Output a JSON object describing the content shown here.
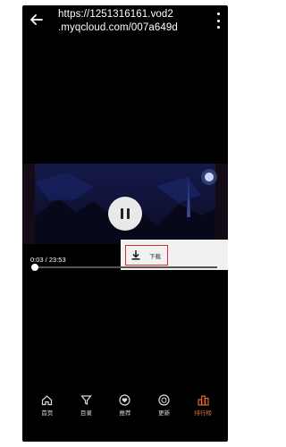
{
  "header": {
    "url": "https://1251316161.vod2\n.myqcloud.com/007a649d"
  },
  "player": {
    "time": "0:03 / 23:53",
    "progress_fraction": 0.02
  },
  "download": {
    "label": "下载"
  },
  "tabs": [
    {
      "label": "首页",
      "icon": "home-icon",
      "active": false
    },
    {
      "label": "目录",
      "icon": "filter-icon",
      "active": false
    },
    {
      "label": "推荐",
      "icon": "heart-icon",
      "active": false
    },
    {
      "label": "更新",
      "icon": "refresh-icon",
      "active": false
    },
    {
      "label": "排行榜",
      "icon": "ranking-icon",
      "active": true
    }
  ],
  "colors": {
    "background": "#000000",
    "active_tab": "#e8702a",
    "highlight_border": "#d9302a"
  }
}
